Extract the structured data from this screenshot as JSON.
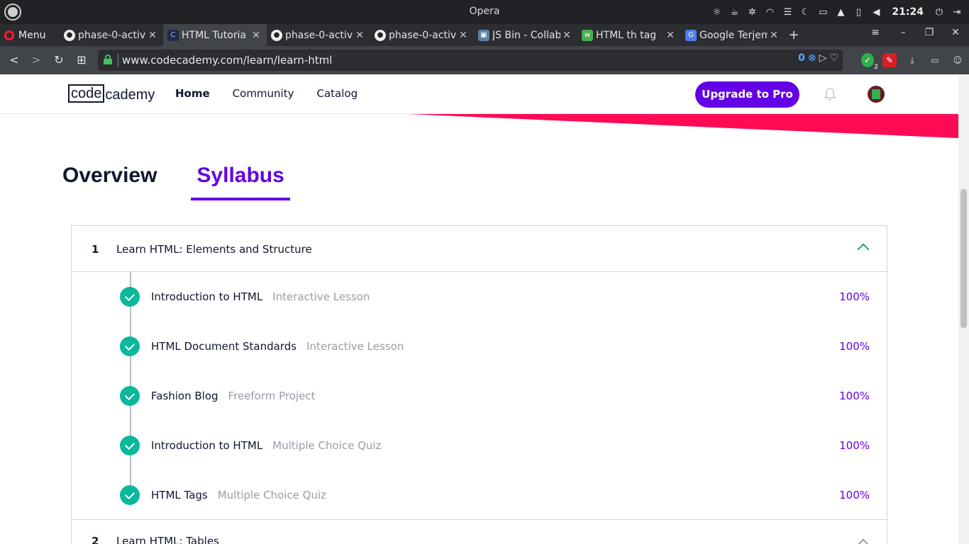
{
  "os": {
    "window_title": "Opera",
    "clock": "21:24"
  },
  "browser": {
    "menu_label": "Menu",
    "tabs": [
      {
        "title": "phase-0-activ",
        "icon": "github-icon",
        "active": false
      },
      {
        "title": "HTML Tutoria",
        "icon": "codecademy-favicon-icon",
        "active": true
      },
      {
        "title": "phase-0-activ",
        "icon": "github-icon",
        "active": false
      },
      {
        "title": "phase-0-activ",
        "icon": "github-icon",
        "active": false
      },
      {
        "title": "JS Bin - Collab",
        "icon": "jsbin-icon",
        "active": false
      },
      {
        "title": "HTML th tag",
        "icon": "w3schools-icon",
        "active": false
      },
      {
        "title": "Google Terjem",
        "icon": "google-translate-icon",
        "active": false
      }
    ],
    "url": "www.codecademy.com/learn/learn-html",
    "blocked_count": "0",
    "badge_count": "2"
  },
  "site": {
    "logo_boxed": "code",
    "logo_rest": "cademy",
    "nav": {
      "home": "Home",
      "community": "Community",
      "catalog": "Catalog"
    },
    "upgrade_label": "Upgrade to Pro",
    "accent": "#6400e4",
    "stripe_color": "#ff0a54"
  },
  "page_tabs": {
    "overview": "Overview",
    "syllabus": "Syllabus",
    "active": "Syllabus"
  },
  "modules": [
    {
      "number": "1",
      "title": "Learn HTML: Elements and Structure",
      "expanded": true,
      "lessons": [
        {
          "title": "Introduction to HTML",
          "type": "Interactive Lesson",
          "progress": "100%"
        },
        {
          "title": "HTML Document Standards",
          "type": "Interactive Lesson",
          "progress": "100%"
        },
        {
          "title": "Fashion Blog",
          "type": "Freeform Project",
          "progress": "100%"
        },
        {
          "title": "Introduction to HTML",
          "type": "Multiple Choice Quiz",
          "progress": "100%"
        },
        {
          "title": "HTML Tags",
          "type": "Multiple Choice Quiz",
          "progress": "100%"
        }
      ]
    },
    {
      "number": "2",
      "title": "Learn HTML: Tables",
      "expanded": false
    }
  ]
}
